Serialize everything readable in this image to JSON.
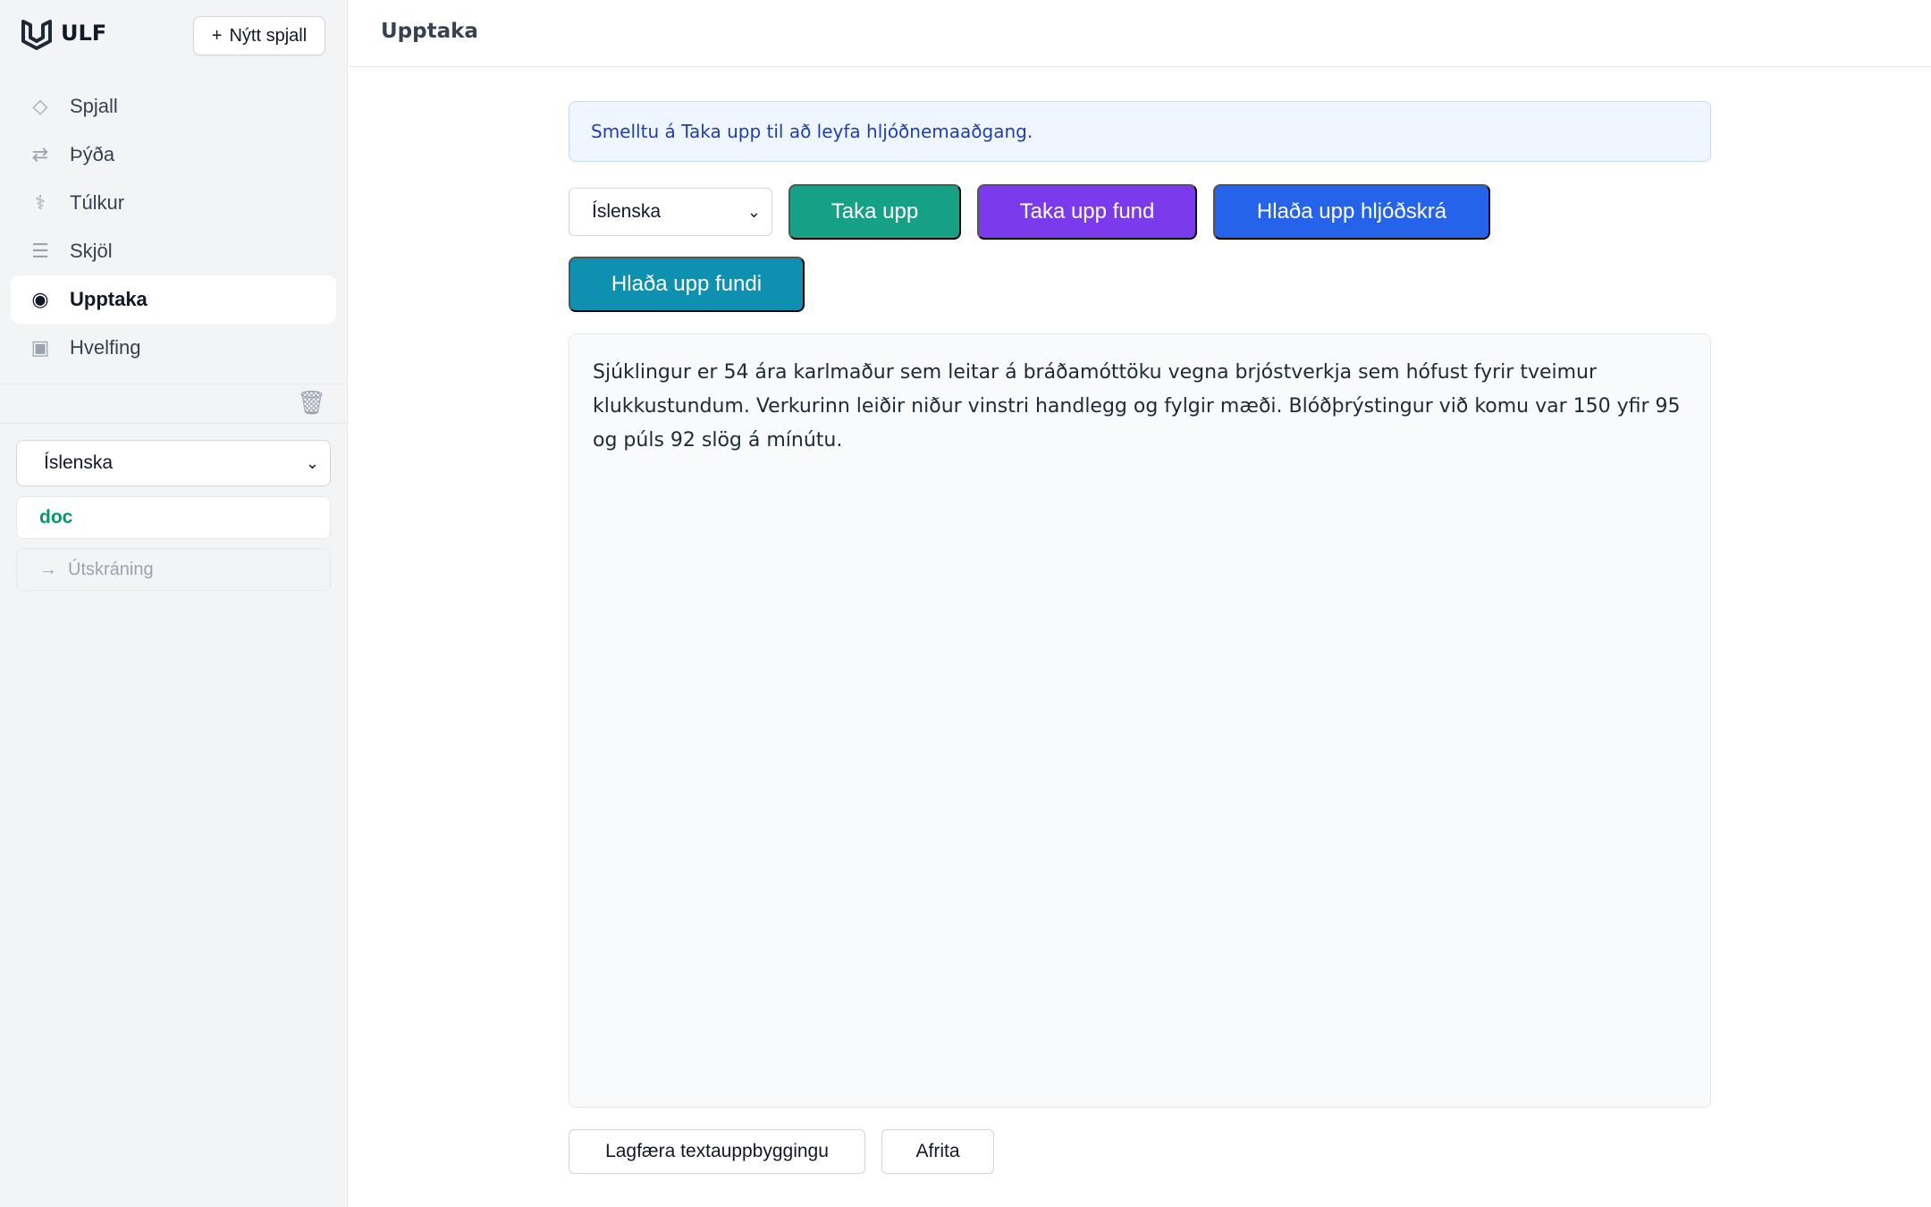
{
  "app": {
    "name": "ULF",
    "new_chat_label": "Nýtt spjall",
    "new_chat_icon": "plus-icon"
  },
  "sidebar": {
    "items": [
      {
        "label": "Spjall",
        "icon": "diamond-icon",
        "glyph": "◇",
        "active": false
      },
      {
        "label": "Þýða",
        "icon": "swap-arrows-icon",
        "glyph": "⇄",
        "active": false
      },
      {
        "label": "Túlkur",
        "icon": "caduceus-icon",
        "glyph": "⚕",
        "active": false
      },
      {
        "label": "Skjöl",
        "icon": "list-icon",
        "glyph": "☰",
        "active": false
      },
      {
        "label": "Upptaka",
        "icon": "record-icon",
        "glyph": "◉",
        "active": true
      },
      {
        "label": "Hvelfing",
        "icon": "vault-icon",
        "glyph": "▣",
        "active": false
      }
    ],
    "trash_icon": "trash-icon",
    "language_select": {
      "value": "Íslenska"
    },
    "user_name": "doc",
    "logout_label": "Útskráning",
    "logout_icon": "arrow-right-icon"
  },
  "header": {
    "title": "Upptaka"
  },
  "main": {
    "info_message": "Smelltu á Taka upp til að leyfa hljóðnemaaðgang.",
    "language_select": {
      "value": "Íslenska"
    },
    "buttons": {
      "record": "Taka upp",
      "record_meeting": "Taka upp fund",
      "upload_audio": "Hlaða upp hljóðskrá",
      "upload_meeting": "Hlaða upp fundi"
    },
    "transcript": "Sjúklingur er 54 ára karlmaður sem leitar á bráðamóttöku vegna brjóstverkja sem hófust fyrir tveimur klukkustundum. Verkurinn leiðir niður vinstri handlegg og fylgir mæði. Blóðþrýstingur við komu var 150 yfir 95 og púls 92 slög á mínútu.",
    "actions": {
      "fix_structure": "Lagfæra textauppbyggingu",
      "copy": "Afrita"
    }
  },
  "colors": {
    "record": "#16a085",
    "record_meeting": "#7c3aed",
    "upload_audio": "#2563eb",
    "upload_meeting": "#0e90b0",
    "info_bg": "#eff6ff",
    "info_text": "#1e40af",
    "user_name": "#059669"
  }
}
